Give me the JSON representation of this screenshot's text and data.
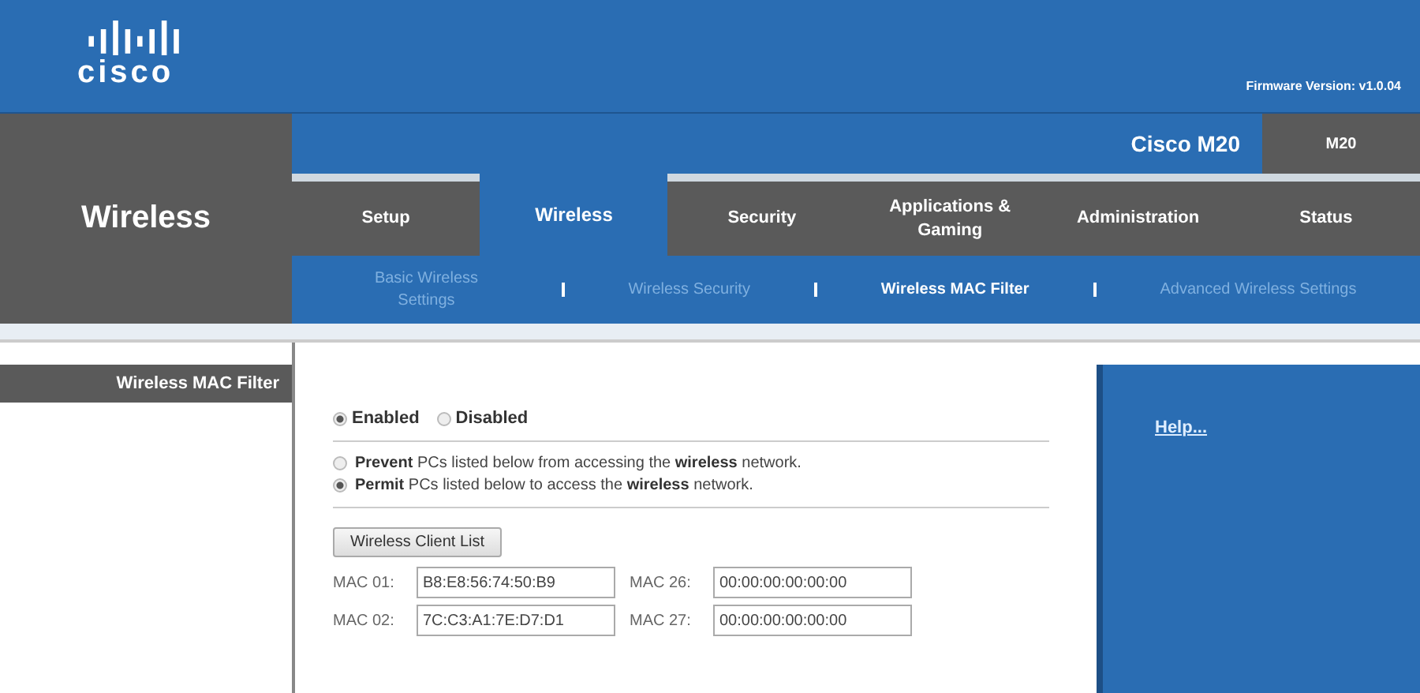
{
  "header": {
    "logo_text": "cisco",
    "firmware": "Firmware Version: v1.0.04"
  },
  "product": {
    "name": "Cisco M20",
    "model": "M20"
  },
  "section_title": "Wireless",
  "tabs": [
    {
      "label": "Setup",
      "selected": false
    },
    {
      "label": "Wireless",
      "selected": true
    },
    {
      "label": "Security",
      "selected": false
    },
    {
      "label": "Applications & Gaming",
      "selected": false
    },
    {
      "label": "Administration",
      "selected": false
    },
    {
      "label": "Status",
      "selected": false
    }
  ],
  "subtabs": [
    {
      "label": "Basic Wireless Settings",
      "selected": false
    },
    {
      "label": "Wireless Security",
      "selected": false
    },
    {
      "label": "Wireless MAC Filter",
      "selected": true
    },
    {
      "label": "Advanced Wireless Settings",
      "selected": false
    }
  ],
  "sidebar_heading": "Wireless MAC Filter",
  "filter_state": [
    {
      "label": "Enabled",
      "selected": true
    },
    {
      "label": "Disabled",
      "selected": false
    }
  ],
  "access_mode": [
    {
      "text": "**Prevent** PCs listed below from accessing the **wireless** network.",
      "selected": false
    },
    {
      "text": "**Permit** PCs listed below to access the **wireless** network.",
      "selected": true
    }
  ],
  "client_list_button": "Wireless Client List",
  "mac_rows": [
    [
      {
        "label": "MAC 01:",
        "value": "B8:E8:56:74:50:B9"
      },
      {
        "label": "MAC 26:",
        "value": "00:00:00:00:00:00"
      }
    ],
    [
      {
        "label": "MAC 02:",
        "value": "7C:C3:A1:7E:D7:D1"
      },
      {
        "label": "MAC 27:",
        "value": "00:00:00:00:00:00"
      }
    ]
  ],
  "help_link": "Help..."
}
